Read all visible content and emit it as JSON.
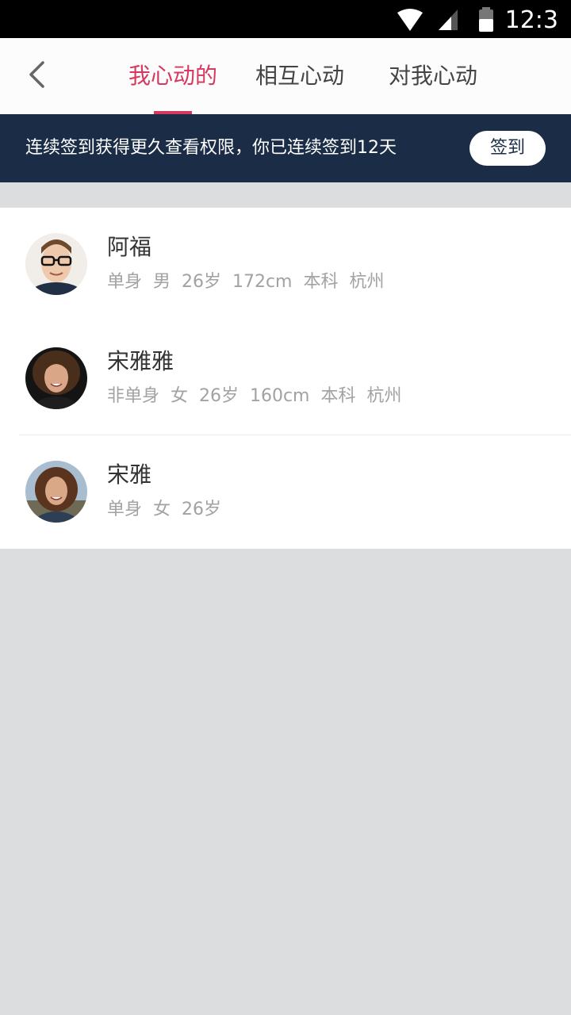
{
  "status_bar": {
    "time": "12:3",
    "icons": [
      "wifi-icon",
      "signal-icon",
      "battery-icon"
    ]
  },
  "nav": {
    "back_icon": "back-arrow-icon",
    "tabs": [
      {
        "label": "我心动的",
        "active": true
      },
      {
        "label": "相互心动",
        "active": false
      },
      {
        "label": "对我心动",
        "active": false
      }
    ]
  },
  "checkin": {
    "text": "连续签到获得更久查看权限，你已连续签到12天",
    "button_label": "签到"
  },
  "users": [
    {
      "name": "阿福",
      "meta": "单身  男  26岁  172cm  本科  杭州"
    },
    {
      "name": "宋雅雅",
      "meta": "非单身  女  26岁  160cm  本科  杭州"
    },
    {
      "name": "宋雅",
      "meta": "单身  女  26岁"
    }
  ],
  "colors": {
    "accent": "#d6395f",
    "banner_bg": "#1b2d46",
    "page_bg": "#dcdddf"
  }
}
